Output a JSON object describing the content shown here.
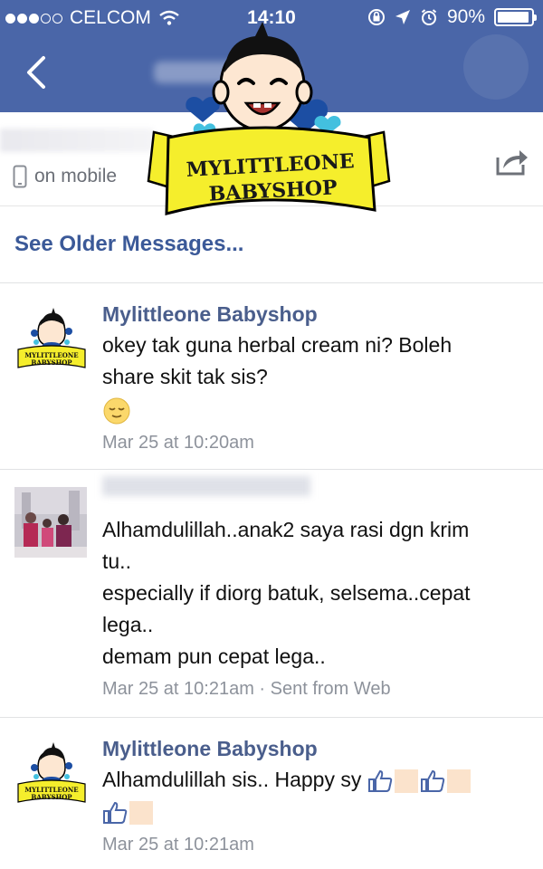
{
  "status_bar": {
    "carrier": "CELCOM",
    "time": "14:10",
    "battery": "90%"
  },
  "nav": {
    "back_icon": "chevron-left-icon"
  },
  "contact": {
    "presence": "on mobile"
  },
  "logo": {
    "line1": "MYLITTLEONE",
    "line2": "BABYSHOP"
  },
  "see_older": "See Older Messages...",
  "messages": [
    {
      "sender": "Mylittleone Babyshop",
      "lines": [
        "okey tak guna herbal cream ni? Boleh",
        "share skit tak sis?"
      ],
      "emoji": "relieved-face",
      "time": "Mar 25 at 10:20am"
    },
    {
      "sender": "",
      "lines": [
        "Alhamdulillah..anak2 saya rasi dgn krim",
        "tu..",
        "especially if diorg batuk, selsema..cepat",
        "lega..",
        "demam pun cepat lega.."
      ],
      "time": "Mar 25 at 10:21am · Sent from Web"
    },
    {
      "sender": "Mylittleone Babyshop",
      "lines": [
        "Alhamdulillah sis.. Happy sy"
      ],
      "time": "Mar 25 at 10:21am"
    }
  ],
  "colors": {
    "nav_blue": "#4a66a8",
    "link_blue": "#3b5998",
    "logo_yellow": "#f5ee2c"
  }
}
